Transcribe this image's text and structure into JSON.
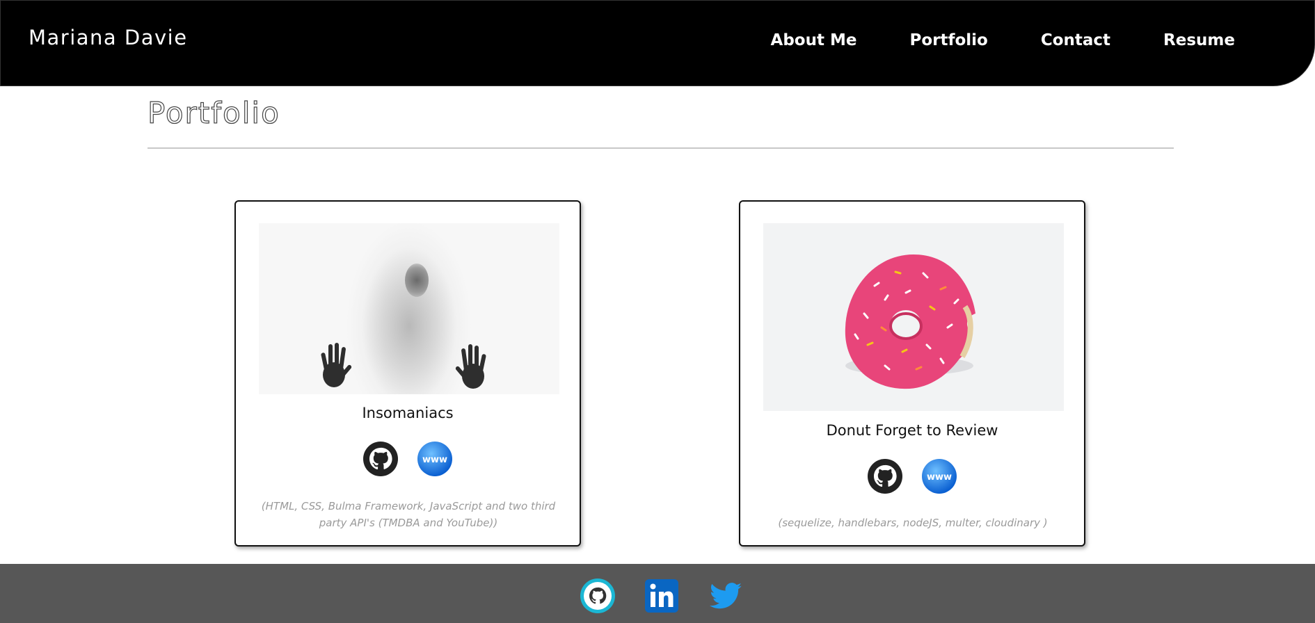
{
  "header": {
    "brand": "Mariana Davie",
    "nav": [
      "About Me",
      "Portfolio",
      "Contact",
      "Resume"
    ]
  },
  "main": {
    "title": "Portfolio",
    "projects": [
      {
        "title": "Insomaniacs",
        "tech": "(HTML, CSS, Bulma Framework, JavaScript and two third party API's (TMDBA and YouTube))",
        "links": [
          "github-icon",
          "www-icon"
        ]
      },
      {
        "title": "Donut Forget to Review",
        "tech": "(sequelize, handlebars, nodeJS, multer, cloudinary )",
        "links": [
          "github-icon",
          "www-icon"
        ]
      }
    ]
  },
  "footer": {
    "social": [
      "github-icon",
      "linkedin-icon",
      "twitter-icon"
    ]
  },
  "colors": {
    "header_bg": "#000000",
    "footer_bg": "#575757",
    "donut_pink": "#e8457a",
    "www_blue": "#1e7fe0",
    "linkedin_blue": "#0a66c2",
    "twitter_blue": "#1d9bf0"
  }
}
